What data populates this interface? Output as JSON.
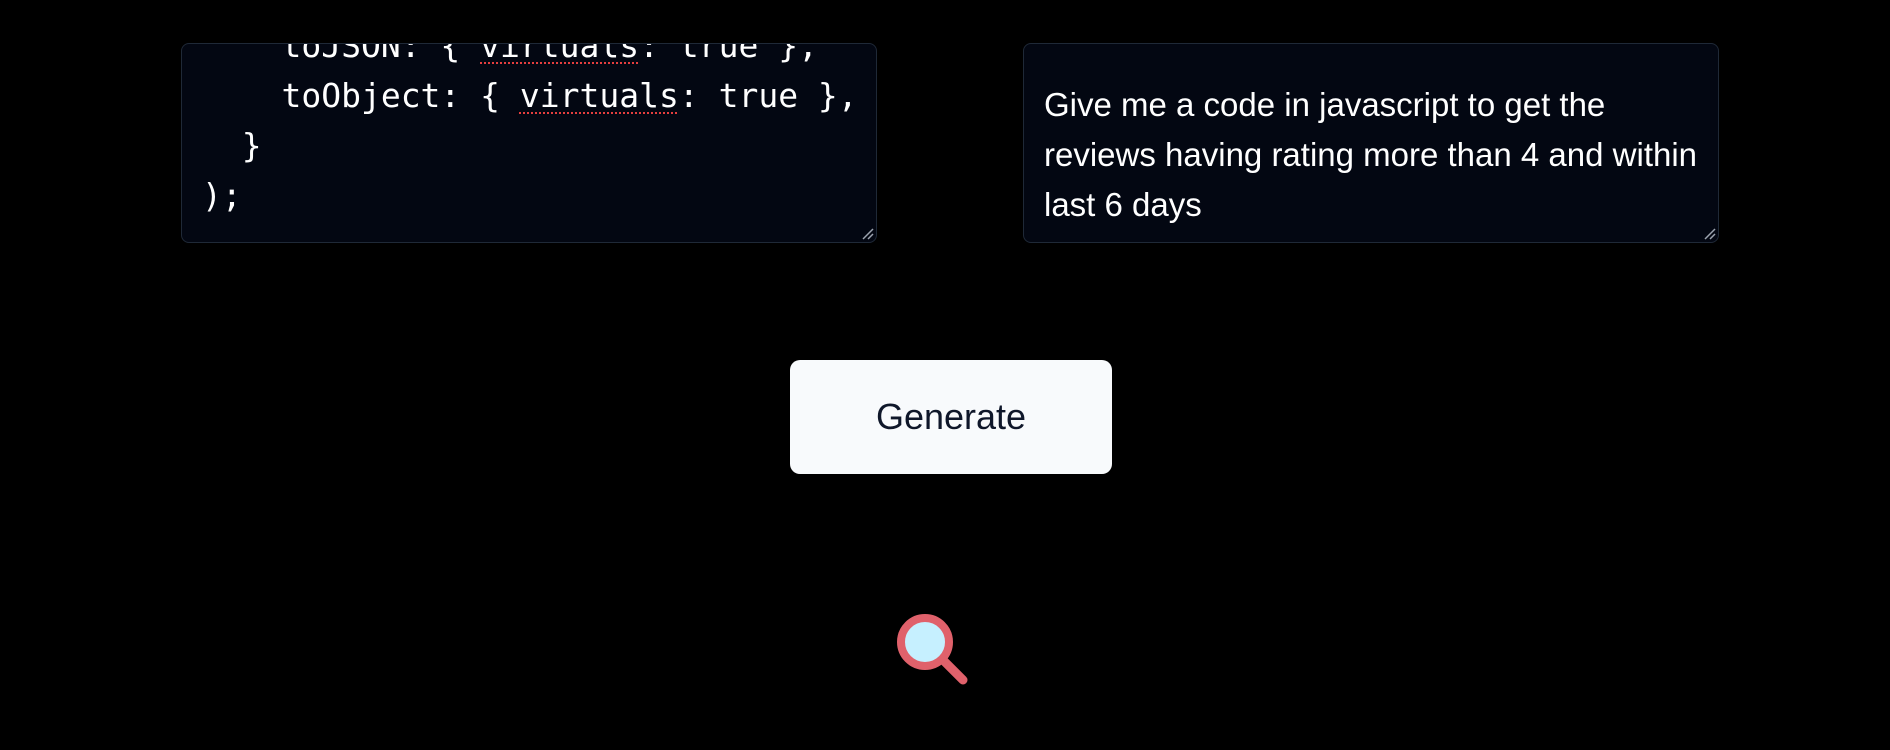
{
  "schema_editor": {
    "line1_indent": "    ",
    "line1_key": "toJSON: { ",
    "line1_word": "virtuals",
    "line1_rest": ": true },",
    "line2_indent": "    ",
    "line2_key": "toObject: { ",
    "line2_word": "virtuals",
    "line2_rest": ": true },",
    "line3": "  }",
    "line4": ");"
  },
  "prompt_editor": {
    "value": "Give me a code in javascript to get the reviews having rating more than 4 and within last 6 days"
  },
  "actions": {
    "generate_label": "Generate"
  },
  "icons": {
    "loading_indicator": "search-icon"
  },
  "colors": {
    "background": "#000000",
    "textbox_bg": "#030712",
    "button_bg": "#f8fafc",
    "button_text": "#0f172a",
    "icon_ring": "#e0616b",
    "icon_lens": "#c6f0ff"
  }
}
